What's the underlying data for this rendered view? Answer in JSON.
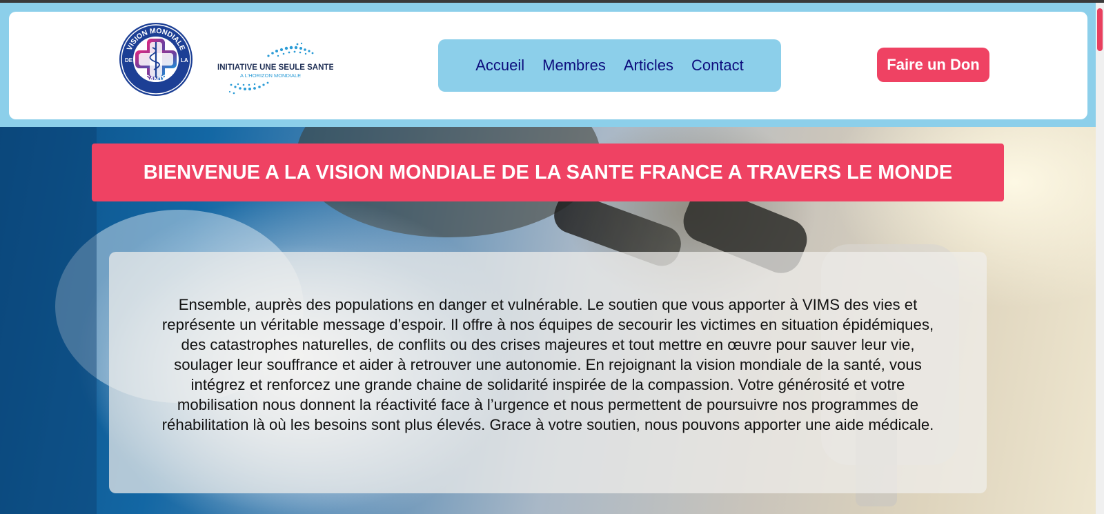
{
  "brand": {
    "logo_ring_top": "VISION MONDIALE",
    "logo_ring_left": "DE",
    "logo_ring_right": "LA",
    "logo_ring_bottom": "SANTE",
    "initiative_title": "INITIATIVE UNE SEULE SANTE",
    "initiative_subtitle": "A L'HORIZON MONDIALE"
  },
  "nav": {
    "items": [
      {
        "label": "Accueil"
      },
      {
        "label": "Membres"
      },
      {
        "label": "Articles"
      },
      {
        "label": "Contact"
      }
    ]
  },
  "donate": {
    "label": "Faire un Don"
  },
  "hero": {
    "banner": "BIENVENUE A LA VISION MONDIALE DE LA SANTE FRANCE A TRAVERS LE MONDE",
    "body": "Ensemble, auprès des populations en danger et vulnérable. Le soutien que vous apporter à VIMS des vies et représente un véritable message d’espoir. Il offre à nos équipes de secourir les victimes en situation épidémiques, des catastrophes naturelles, de conflits ou des crises majeures et tout mettre en œuvre pour sauver leur vie, soulager leur souffrance et aider à retrouver une autonomie. En rejoignant la vision mondiale de la santé, vous intégrez et renforcez une grande chaine de solidarité inspirée de la compassion. Votre générosité et votre mobilisation nous donnent la réactivité face à l’urgence et nous permettent de poursuivre nos programmes de réhabilitation là où les besoins sont plus élevés. Grace à votre soutien, nous pouvons apporter une aide médicale."
  },
  "colors": {
    "accent_pink": "#ef4263",
    "header_blue": "#8ccfea",
    "nav_text": "#0d0d7d"
  }
}
